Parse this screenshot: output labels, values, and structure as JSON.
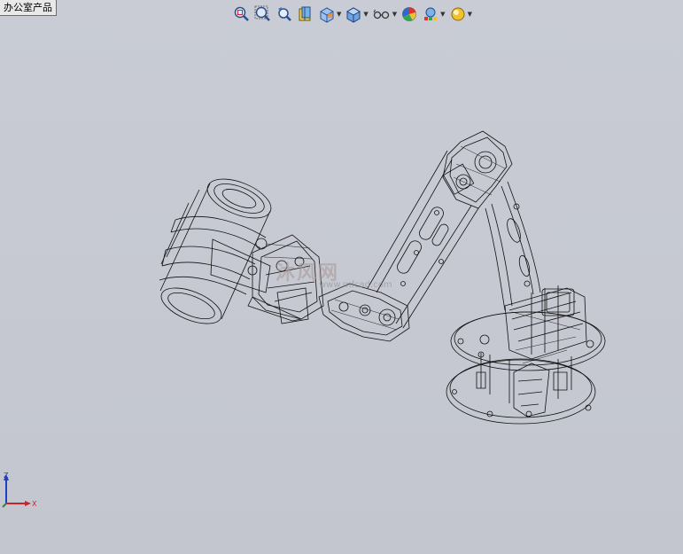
{
  "document_tab": {
    "label": "办公室产品"
  },
  "toolbar": {
    "buttons": [
      {
        "icon": "zoom-to-fit-icon"
      },
      {
        "icon": "zoom-to-area-icon"
      },
      {
        "icon": "previous-view-icon"
      },
      {
        "icon": "section-view-icon"
      },
      {
        "icon": "view-orientation-icon",
        "has_dropdown": true
      },
      {
        "icon": "display-style-icon",
        "has_dropdown": true
      },
      {
        "icon": "hide-show-items-icon",
        "has_dropdown": true
      },
      {
        "icon": "edit-appearance-icon"
      },
      {
        "icon": "apply-scene-icon",
        "has_dropdown": true
      },
      {
        "icon": "view-settings-icon",
        "has_dropdown": true
      }
    ]
  },
  "watermark": {
    "text": "沐风网",
    "url": "www.mfcad.com"
  },
  "triad": {
    "axis_z": "Z",
    "axis_x": "X"
  },
  "colors": {
    "background": "#c6c9d2",
    "axis_z": "#1f3fbf",
    "axis_x": "#c4262e",
    "axis_y": "#2e8b2e"
  }
}
